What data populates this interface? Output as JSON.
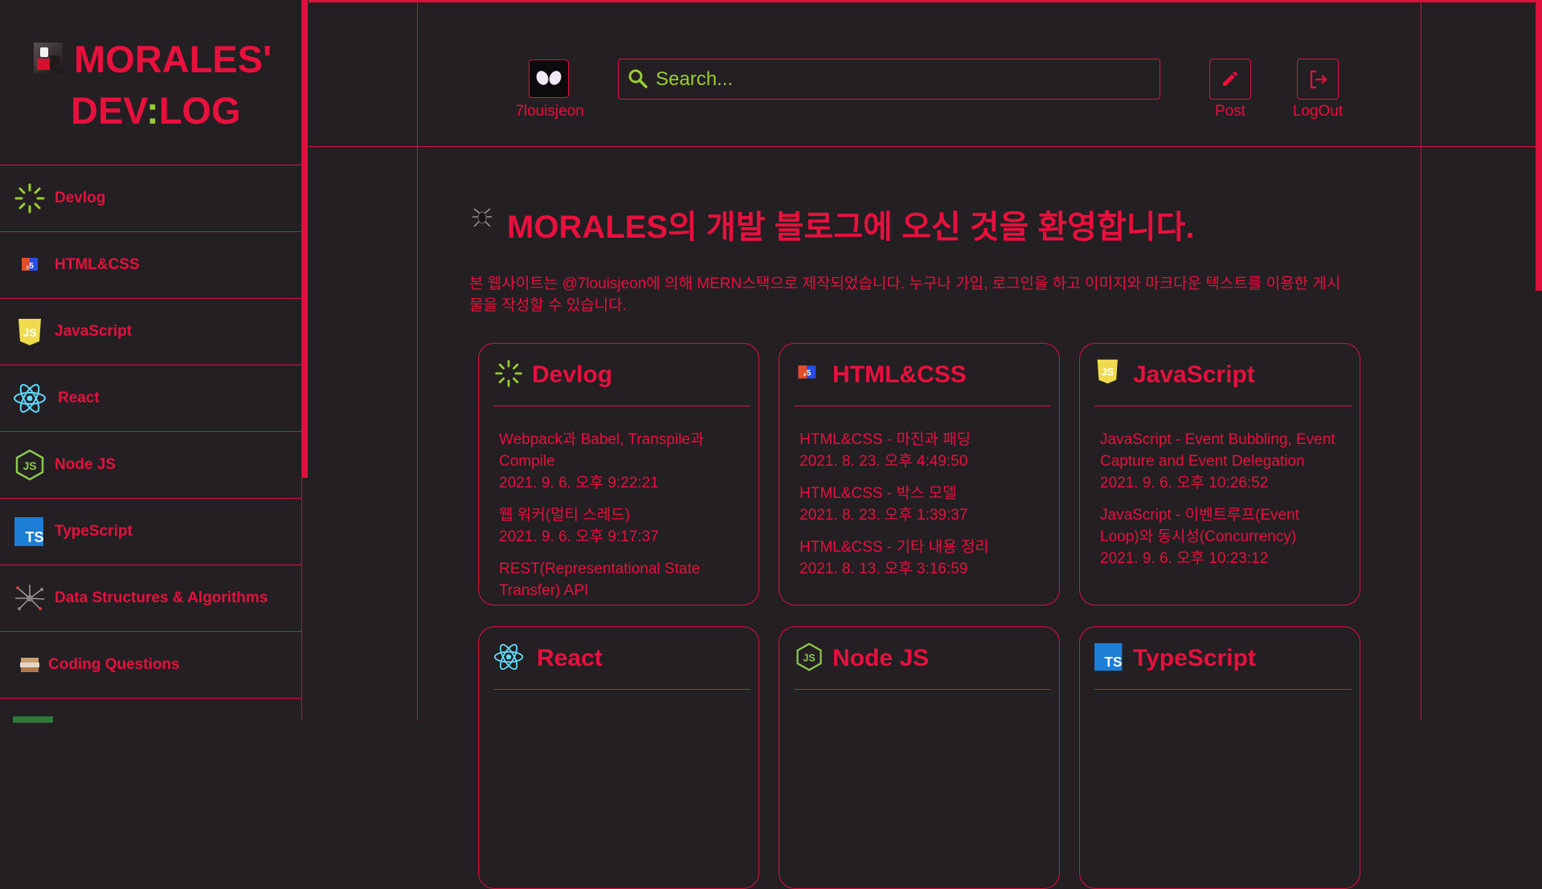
{
  "logo": {
    "line1": "MORALES'",
    "line2_a": "DEV",
    "line2_colon": ":",
    "line2_b": "LOG"
  },
  "sidebar": {
    "items": [
      {
        "label": "Devlog",
        "icon": "devlog-spinner-icon"
      },
      {
        "label": "HTML&CSS",
        "icon": "html5-icon"
      },
      {
        "label": "JavaScript",
        "icon": "javascript-icon"
      },
      {
        "label": "React",
        "icon": "react-icon"
      },
      {
        "label": "Node JS",
        "icon": "nodejs-icon"
      },
      {
        "label": "TypeScript",
        "icon": "typescript-icon"
      },
      {
        "label": "Data Structures & Algorithms",
        "icon": "network-icon"
      },
      {
        "label": "Coding Questions",
        "icon": "books-icon"
      }
    ]
  },
  "header": {
    "username": "7louisjeon",
    "search_placeholder": "Search...",
    "post_label": "Post",
    "logout_label": "LogOut"
  },
  "main": {
    "title": "MORALES의 개발 블로그에 오신 것을 환영합니다.",
    "description": "본 웹사이트는 @7louisjeon에 의해 MERN스택으로 제작되었습니다. 누구나 가입, 로그인을 하고 이미지와 마크다운 텍스트를 이용한 게시물을 작성할 수 있습니다.",
    "cards": [
      {
        "title": "Devlog",
        "posts": [
          {
            "title": "Webpack과 Babel, Transpile과 Compile",
            "date": "2021. 9. 6. 오후 9:22:21"
          },
          {
            "title": "웹 워커(멀티 스레드)",
            "date": "2021. 9. 6. 오후 9:17:37"
          },
          {
            "title": "REST(Representational State Transfer) API",
            "date": ""
          }
        ]
      },
      {
        "title": "HTML&CSS",
        "posts": [
          {
            "title": "HTML&CSS - 마진과 패딩",
            "date": "2021. 8. 23. 오후 4:49:50"
          },
          {
            "title": "HTML&CSS - 박스 모델",
            "date": "2021. 8. 23. 오후 1:39:37"
          },
          {
            "title": "HTML&CSS - 기타 내용 정리",
            "date": "2021. 8. 13. 오후 3:16:59"
          }
        ]
      },
      {
        "title": "JavaScript",
        "posts": [
          {
            "title": "JavaScript - Event Bubbling, Event Capture and Event Delegation",
            "date": "2021. 9. 6. 오후 10:26:52"
          },
          {
            "title": "JavaScript - 이벤트루프(Event Loop)와 동시성(Concurrency)",
            "date": "2021. 9. 6. 오후 10:23:12"
          }
        ]
      },
      {
        "title": "React",
        "posts": []
      },
      {
        "title": "Node JS",
        "posts": []
      },
      {
        "title": "TypeScript",
        "posts": []
      }
    ]
  },
  "colors": {
    "background": "#231f23",
    "accent": "#e8103d",
    "highlight": "#9acd32"
  }
}
